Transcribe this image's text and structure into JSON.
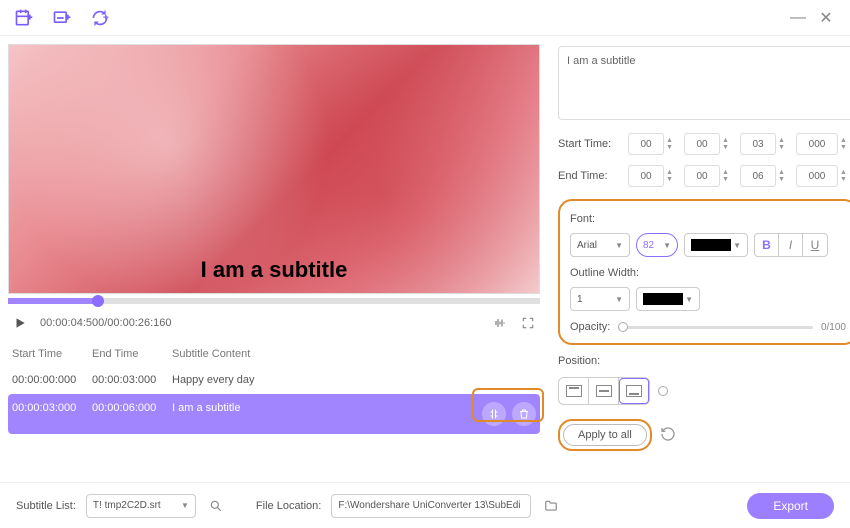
{
  "toolbar": {
    "add_video": "",
    "add_subtitle": "",
    "sync": ""
  },
  "video": {
    "overlay": "I am a subtitle"
  },
  "playbar": {
    "time": "00:00:04:500/00:00:26:160"
  },
  "table": {
    "headers": {
      "start": "Start Time",
      "end": "End Time",
      "content": "Subtitle Content"
    },
    "rows": [
      {
        "start": "00:00:00:000",
        "end": "00:00:03:000",
        "content": "Happy every day"
      },
      {
        "start": "00:00:03:000",
        "end": "00:00:06:000",
        "content": "I am a subtitle"
      }
    ]
  },
  "editor": {
    "text": "I am a subtitle",
    "start_label": "Start Time:",
    "end_label": "End Time:",
    "start": {
      "h": "00",
      "m": "00",
      "s": "03",
      "ms": "000"
    },
    "end": {
      "h": "00",
      "m": "00",
      "s": "06",
      "ms": "000"
    },
    "font_label": "Font:",
    "font": "Arial",
    "size": "82",
    "outline_label": "Outline Width:",
    "outline_width": "1",
    "opacity_label": "Opacity:",
    "opacity": "0/100",
    "position_label": "Position:",
    "apply": "Apply to all"
  },
  "footer": {
    "sub_list_label": "Subtitle List:",
    "sub_file": "T! tmp2C2D.srt",
    "loc_label": "File Location:",
    "loc": "F:\\Wondershare UniConverter 13\\SubEdi",
    "export": "Export"
  }
}
